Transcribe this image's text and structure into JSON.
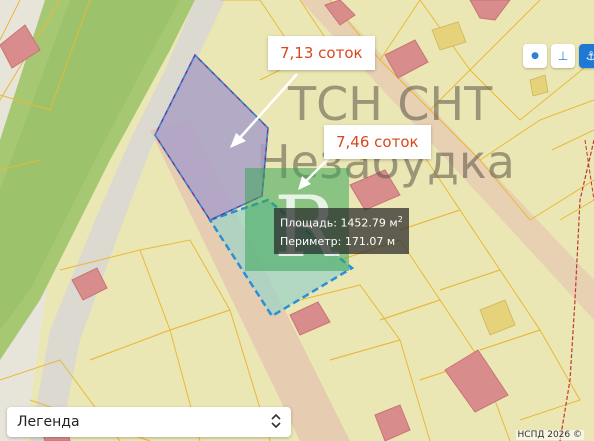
{
  "map": {
    "area_label": "ТСН СНТ Незабудка",
    "area_label_parts": [
      "ТСН СНТ",
      "Незабудка"
    ],
    "watermark_letter": "R"
  },
  "callouts": {
    "parcel_1": "7,13 соток",
    "parcel_2": "7,46 соток"
  },
  "measurement": {
    "area_prefix": "Площадь: ",
    "area_value": "1452.79 м",
    "area_sup": "2",
    "perimeter_prefix": "Периметр: ",
    "perimeter_value": "171.07 м"
  },
  "tools": {
    "point_icon": "dot-icon",
    "measure_icon": "ruler-icon",
    "settings_icon": "compass-icon",
    "point_symbol": "●",
    "measure_symbol": "⊥",
    "settings_symbol": "⚓"
  },
  "legend": {
    "label": "Легенда",
    "chevron": "⌃⌄"
  },
  "attribution": "НСПД 2026 ©",
  "colors": {
    "parcel_fill": "#ebe7b4",
    "parcel_border": "#e8b93a",
    "building": "#d98c8c",
    "selected_1_fill": "#a9a0c9",
    "selected_1_border": "#7a2f8a",
    "selected_2_fill": "#9fd3c7",
    "selected_2_border": "#2a8fd6",
    "green_strip": "#9cc26b",
    "road": "#d9d6cf"
  }
}
